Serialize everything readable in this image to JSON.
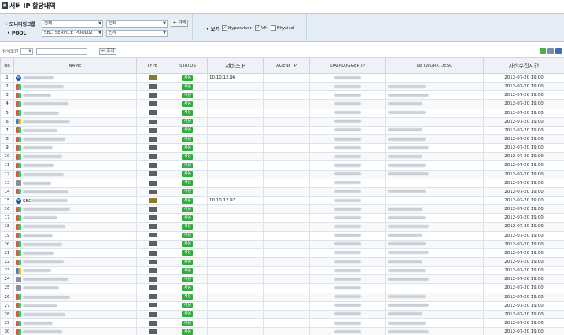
{
  "title": "서버 IP 할당내역",
  "filters": {
    "monitor_group_label": "• 모니터링그룹",
    "monitor_group_value1": "전체",
    "monitor_group_value2": "전체",
    "pool_label": "• POOL",
    "pool_value1": "SBC_SERVICE_POOL02",
    "pool_value2": "전체",
    "search_button": "← 검색",
    "view_label": "• 보기",
    "checkbox_hypervisor": "Hypervisor",
    "checkbox_vm": "VM",
    "checkbox_physical": "Physical"
  },
  "search": {
    "label": "검색조건",
    "button": "← 조회"
  },
  "table": {
    "headers": {
      "no": "No",
      "name": "NAME",
      "type": "TYPE",
      "status": "STATUS",
      "service_ip": "서비스IP",
      "agent_ip": "AGENT IP",
      "datalogger_ip": "DATALOGGER IP",
      "network_desc": "NETWORK DESC",
      "collected_time": "자산수집시간"
    },
    "rows": [
      {
        "no": "1",
        "type": "HV",
        "status": "사용",
        "service_ip": "10.10.12.96",
        "time": "2012-07-20 19:00",
        "icon": "hv",
        "name_prefix": ""
      },
      {
        "no": "2",
        "type": "VM",
        "status": "사용",
        "service_ip": "",
        "time": "2012-07-20 19:00",
        "icon": "win",
        "name_prefix": ""
      },
      {
        "no": "3",
        "type": "VM",
        "status": "사용",
        "service_ip": "",
        "time": "2012-07-20 19:00",
        "icon": "win",
        "name_prefix": ""
      },
      {
        "no": "4",
        "type": "VM",
        "status": "사용",
        "service_ip": "",
        "time": "2012-07-20 19:00",
        "icon": "win",
        "name_prefix": ""
      },
      {
        "no": "5",
        "type": "VM",
        "status": "사용",
        "service_ip": "",
        "time": "2012-07-20 19:00",
        "icon": "win",
        "name_prefix": ""
      },
      {
        "no": "6",
        "type": "VM",
        "status": "사용",
        "service_ip": "",
        "time": "2012-07-20 19:00",
        "icon": "win2",
        "name_prefix": ""
      },
      {
        "no": "7",
        "type": "VM",
        "status": "사용",
        "service_ip": "",
        "time": "2012-07-20 19:00",
        "icon": "win",
        "name_prefix": ""
      },
      {
        "no": "8",
        "type": "VM",
        "status": "사용",
        "service_ip": "",
        "time": "2012-07-20 19:00",
        "icon": "win",
        "name_prefix": ""
      },
      {
        "no": "9",
        "type": "VM",
        "status": "사용",
        "service_ip": "",
        "time": "2012-07-20 19:00",
        "icon": "win",
        "name_prefix": ""
      },
      {
        "no": "10",
        "type": "VM",
        "status": "사용",
        "service_ip": "",
        "time": "2012-07-20 19:00",
        "icon": "win",
        "name_prefix": ""
      },
      {
        "no": "11",
        "type": "VM",
        "status": "사용",
        "service_ip": "",
        "time": "2012-07-20 19:00",
        "icon": "win",
        "name_prefix": ""
      },
      {
        "no": "12",
        "type": "VM",
        "status": "사용",
        "service_ip": "",
        "time": "2012-07-20 19:00",
        "icon": "win",
        "name_prefix": ""
      },
      {
        "no": "13",
        "type": "VM",
        "status": "사용",
        "service_ip": "",
        "time": "2012-07-20 19:00",
        "icon": "vm",
        "name_prefix": ""
      },
      {
        "no": "14",
        "type": "VM",
        "status": "사용",
        "service_ip": "",
        "time": "2012-07-20 19:00",
        "icon": "win",
        "name_prefix": ""
      },
      {
        "no": "15",
        "type": "HV",
        "status": "사용",
        "service_ip": "10.10.12.97",
        "time": "2012-07-20 19:00",
        "icon": "hv",
        "name_prefix": "SBC"
      },
      {
        "no": "16",
        "type": "VM",
        "status": "사용",
        "service_ip": "",
        "time": "2012-07-20 19:00",
        "icon": "win",
        "name_prefix": ""
      },
      {
        "no": "17",
        "type": "VM",
        "status": "사용",
        "service_ip": "",
        "time": "2012-07-20 19:00",
        "icon": "win",
        "name_prefix": ""
      },
      {
        "no": "18",
        "type": "VM",
        "status": "사용",
        "service_ip": "",
        "time": "2012-07-20 19:00",
        "icon": "win",
        "name_prefix": ""
      },
      {
        "no": "19",
        "type": "VM",
        "status": "사용",
        "service_ip": "",
        "time": "2012-07-20 19:00",
        "icon": "win",
        "name_prefix": ""
      },
      {
        "no": "20",
        "type": "VM",
        "status": "사용",
        "service_ip": "",
        "time": "2012-07-20 19:00",
        "icon": "win",
        "name_prefix": ""
      },
      {
        "no": "21",
        "type": "VM",
        "status": "사용",
        "service_ip": "",
        "time": "2012-07-20 19:00",
        "icon": "win",
        "name_prefix": ""
      },
      {
        "no": "22",
        "type": "VM",
        "status": "사용",
        "service_ip": "",
        "time": "2012-07-20 19:00",
        "icon": "win",
        "name_prefix": ""
      },
      {
        "no": "23",
        "type": "VM",
        "status": "사용",
        "service_ip": "",
        "time": "2012-07-20 19:00",
        "icon": "win2",
        "name_prefix": ""
      },
      {
        "no": "24",
        "type": "VM",
        "status": "사용",
        "service_ip": "",
        "time": "2012-07-20 19:00",
        "icon": "vm",
        "name_prefix": ""
      },
      {
        "no": "25",
        "type": "VM",
        "status": "사용",
        "service_ip": "",
        "time": "2012-07-20 19:00",
        "icon": "vm",
        "name_prefix": ""
      },
      {
        "no": "26",
        "type": "VM",
        "status": "사용",
        "service_ip": "",
        "time": "2012-07-20 19:00",
        "icon": "win",
        "name_prefix": ""
      },
      {
        "no": "27",
        "type": "VM",
        "status": "사용",
        "service_ip": "",
        "time": "2012-07-20 19:00",
        "icon": "win",
        "name_prefix": ""
      },
      {
        "no": "28",
        "type": "VM",
        "status": "사용",
        "service_ip": "",
        "time": "2012-07-20 19:00",
        "icon": "win",
        "name_prefix": ""
      },
      {
        "no": "29",
        "type": "VM",
        "status": "사용",
        "service_ip": "",
        "time": "2012-07-20 19:00",
        "icon": "win",
        "name_prefix": ""
      },
      {
        "no": "30",
        "type": "VM",
        "status": "사용",
        "service_ip": "",
        "time": "2012-07-20 19:00",
        "icon": "win",
        "name_prefix": ""
      }
    ]
  },
  "colors": {
    "panel_bg": "#e4ecf5",
    "status_green": "#2fae3b",
    "header_bg": "#eef1f5"
  }
}
